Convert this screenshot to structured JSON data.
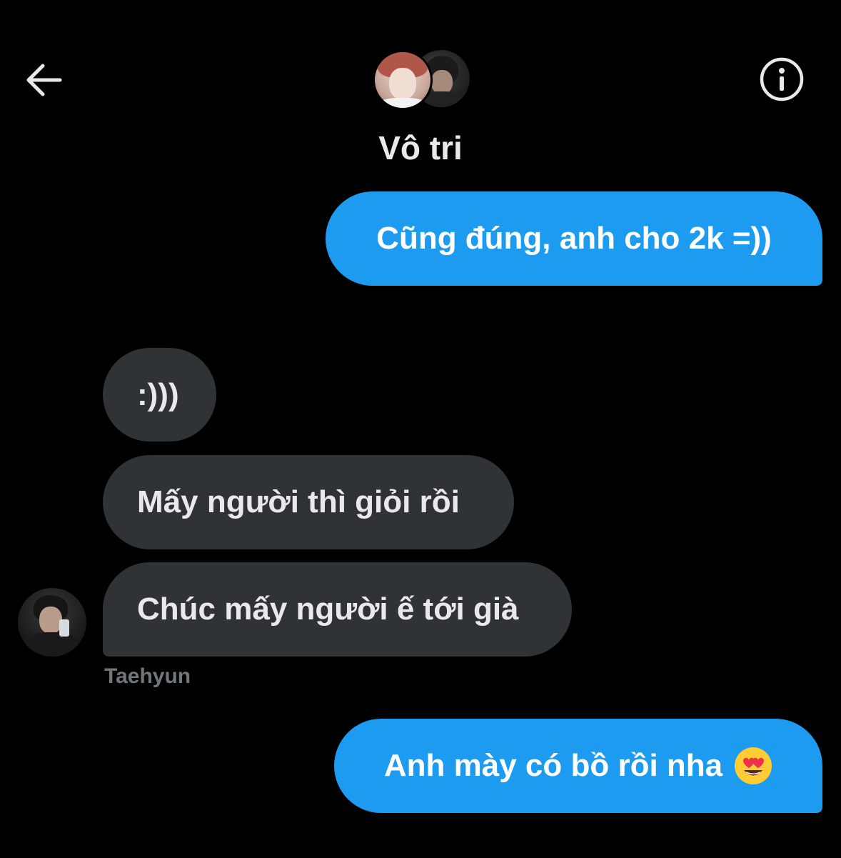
{
  "header": {
    "title": "Vô tri",
    "back_icon": "arrow-left-icon",
    "info_icon": "info-icon"
  },
  "messages": [
    {
      "direction": "sent",
      "text": "Cũng đúng, anh cho 2k =))"
    },
    {
      "direction": "received",
      "text": ":)))"
    },
    {
      "direction": "received",
      "text": "Mấy người thì giỏi rồi"
    },
    {
      "direction": "received",
      "text": "Chúc mấy người ế tới già"
    },
    {
      "direction": "sent",
      "text": "Anh mày có bồ rồi nha",
      "emoji": "heart-eyes-emoji"
    }
  ],
  "sender": {
    "name": "Taehyun"
  },
  "colors": {
    "background": "#000000",
    "sent_bubble": "#1d9bf0",
    "received_bubble": "#2f3336",
    "text_primary": "#e7e9ea",
    "text_secondary": "#71767b"
  }
}
